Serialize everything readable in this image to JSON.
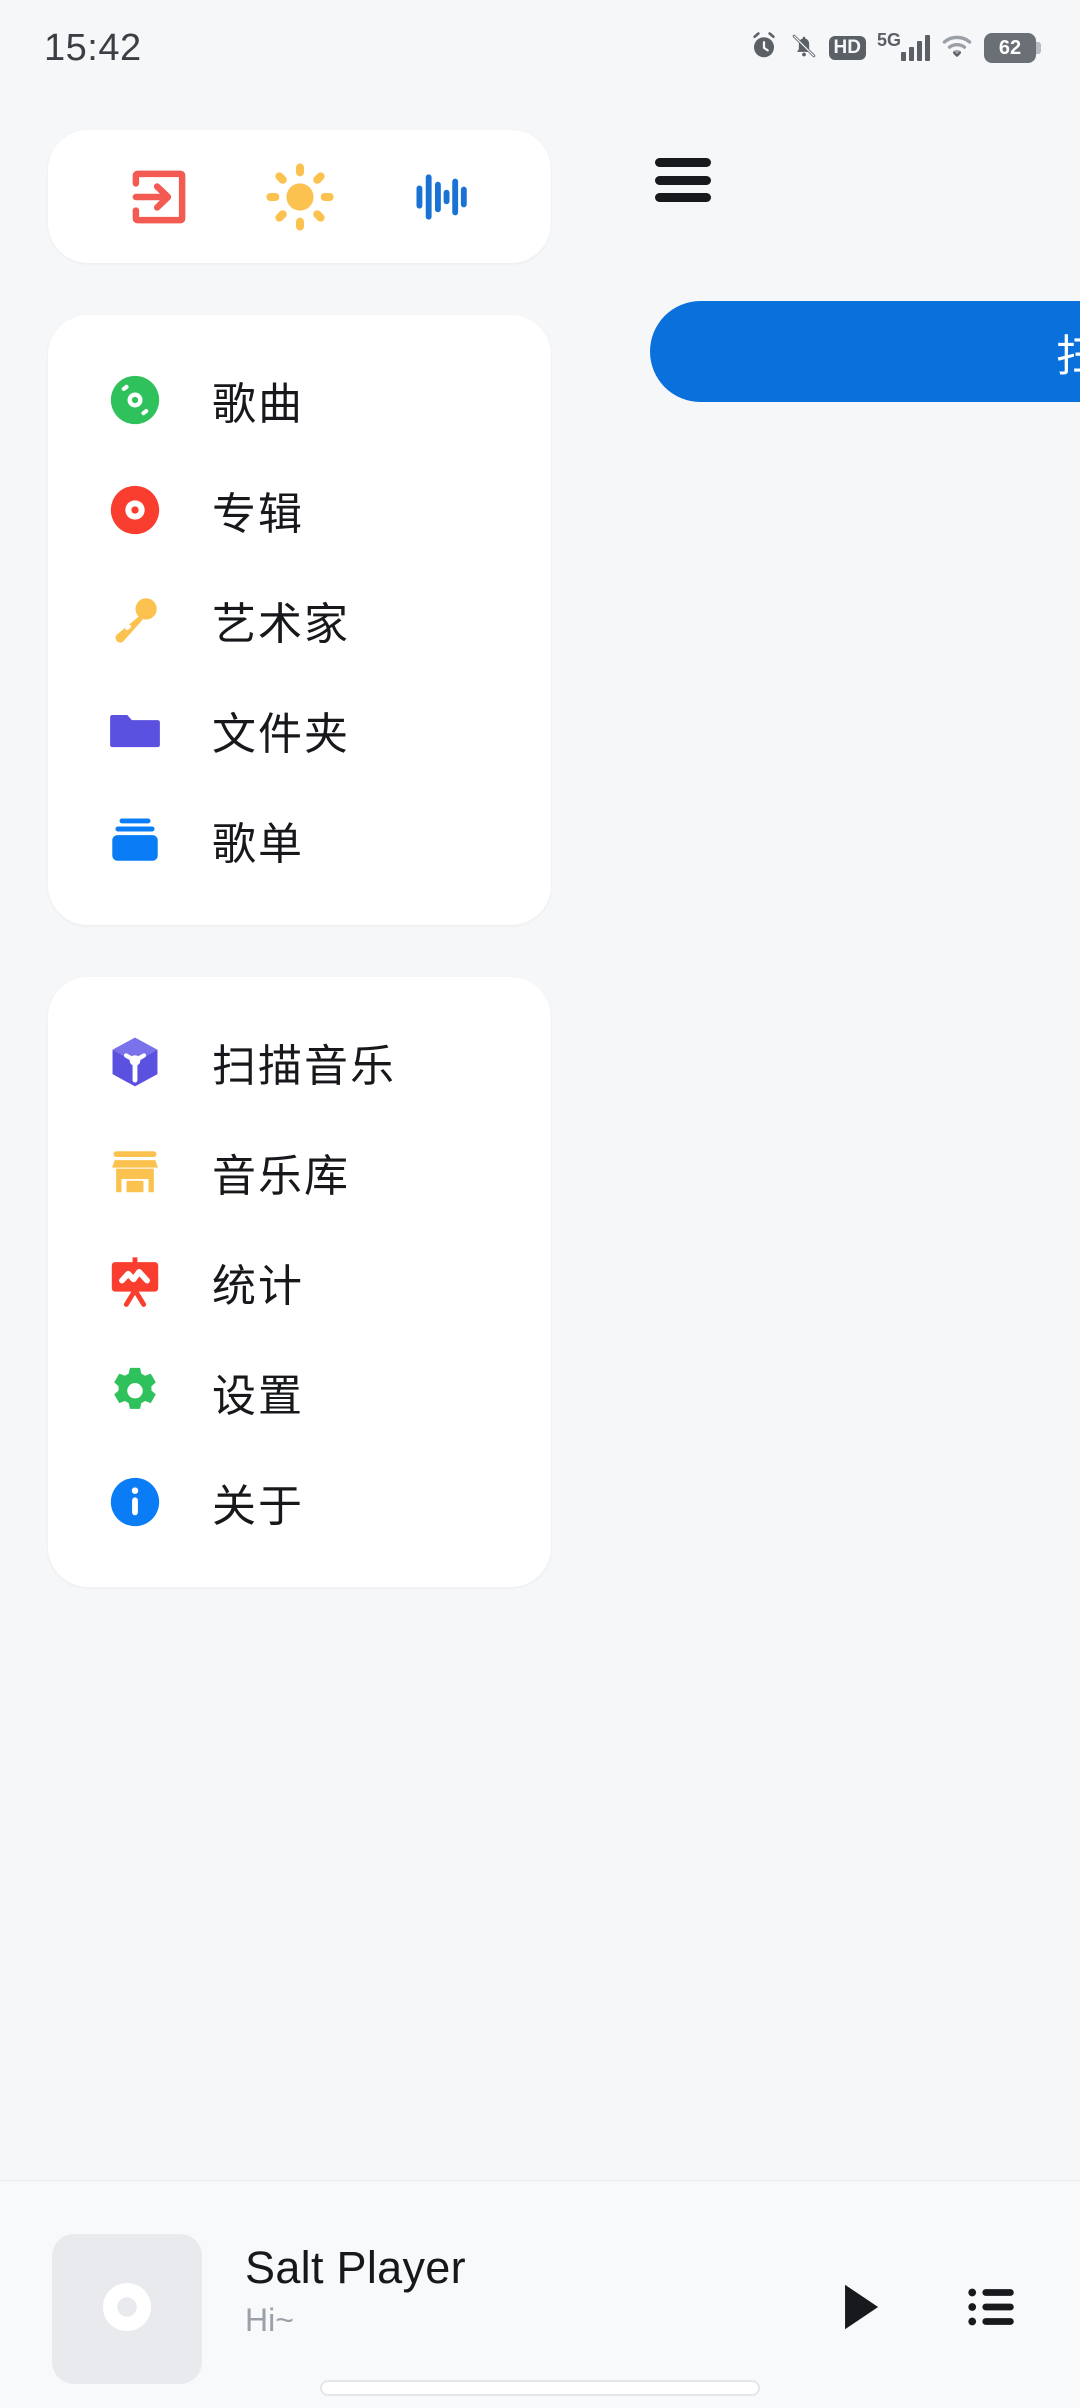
{
  "status_bar": {
    "time": "15:42",
    "icons": [
      "alarm-icon",
      "bell-muted-icon",
      "hd-icon",
      "signal-5g-icon",
      "wifi-icon",
      "battery-icon"
    ],
    "hd_label": "HD",
    "network_label": "5G",
    "battery_level": "62"
  },
  "drawer": {
    "quick_actions": [
      {
        "name": "exit-icon",
        "label": "退出",
        "color": "#f25a52"
      },
      {
        "name": "sun-icon",
        "label": "主题",
        "color": "#fbc24f"
      },
      {
        "name": "equalizer-icon",
        "label": "音效",
        "color": "#1a73d4"
      }
    ],
    "library_items": [
      {
        "label": "歌曲",
        "icon": "disc-green-icon",
        "color": "#2fc15c"
      },
      {
        "label": "专辑",
        "icon": "disc-red-icon",
        "color": "#f93d2e"
      },
      {
        "label": "艺术家",
        "icon": "microphone-icon",
        "color": "#fbc24f"
      },
      {
        "label": "文件夹",
        "icon": "folder-icon",
        "color": "#5b51e0"
      },
      {
        "label": "歌单",
        "icon": "playlist-stack-icon",
        "color": "#0a7cf5"
      }
    ],
    "tool_items": [
      {
        "label": "扫描音乐",
        "icon": "scan-cube-icon",
        "color": "#5b51e0"
      },
      {
        "label": "音乐库",
        "icon": "store-icon",
        "color": "#fbc24f"
      },
      {
        "label": "统计",
        "icon": "chart-board-icon",
        "color": "#f93d2e"
      },
      {
        "label": "设置",
        "icon": "gear-icon",
        "color": "#2fc15c"
      },
      {
        "label": "关于",
        "icon": "info-circle-icon",
        "color": "#0a7cf5"
      }
    ]
  },
  "content": {
    "menu_icon": "hamburger-icon",
    "scan_button_label": "扫描音乐",
    "accent_color": "#0a70dc"
  },
  "player": {
    "album_art_icon": "disc-placeholder-icon",
    "title": "Salt Player",
    "subtitle": "Hi~",
    "play_icon": "play-icon",
    "queue_icon": "queue-list-icon"
  }
}
